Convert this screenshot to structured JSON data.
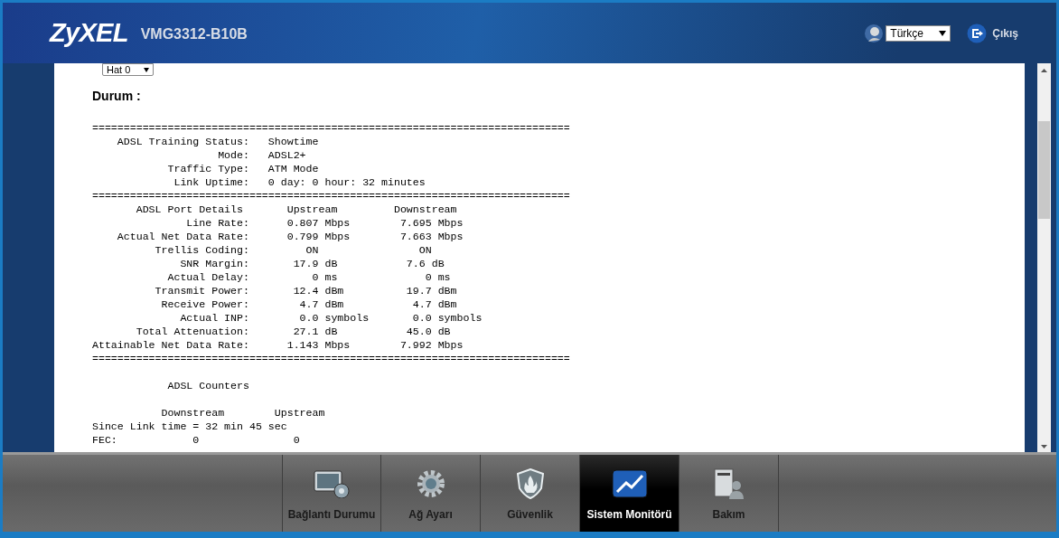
{
  "header": {
    "logo": "ZyXEL",
    "model": "VMG3312-B10B",
    "language": "Türkçe",
    "logout": "Çıkış"
  },
  "content": {
    "line_select": "Hat 0",
    "heading": "Durum :",
    "report": [
      {
        "lines": [
          "============================================================================",
          "    ADSL Training Status:   Showtime",
          "                    Mode:   ADSL2+",
          "            Traffic Type:   ATM Mode",
          "             Link Uptime:   0 day: 0 hour: 32 minutes",
          "============================================================================",
          "       ADSL Port Details       Upstream         Downstream",
          "               Line Rate:      0.807 Mbps        7.695 Mbps",
          "    Actual Net Data Rate:      0.799 Mbps        7.663 Mbps",
          "          Trellis Coding:         ON                ON",
          "              SNR Margin:       17.9 dB           7.6 dB",
          "            Actual Delay:          0 ms              0 ms",
          "          Transmit Power:       12.4 dBm          19.7 dBm",
          "           Receive Power:        4.7 dBm           4.7 dBm",
          "              Actual INP:        0.0 symbols       0.0 symbols",
          "       Total Attenuation:       27.1 dB           45.0 dB",
          "Attainable Net Data Rate:      1.143 Mbps        7.992 Mbps",
          "============================================================================"
        ]
      },
      {
        "lines": [
          "            ADSL Counters"
        ]
      },
      {
        "lines": [
          "           Downstream        Upstream",
          "Since Link time = 32 min 45 sec",
          "FEC:            0               0"
        ]
      }
    ]
  },
  "nav": [
    {
      "kind": "connection",
      "label": "Bağlantı Durumu",
      "selected": false
    },
    {
      "kind": "network",
      "label": "Ağ Ayarı",
      "selected": false
    },
    {
      "kind": "security",
      "label": "Güvenlik",
      "selected": false
    },
    {
      "kind": "monitor",
      "label": "Sistem Monitörü",
      "selected": true
    },
    {
      "kind": "maintenance",
      "label": "Bakım",
      "selected": false
    }
  ]
}
